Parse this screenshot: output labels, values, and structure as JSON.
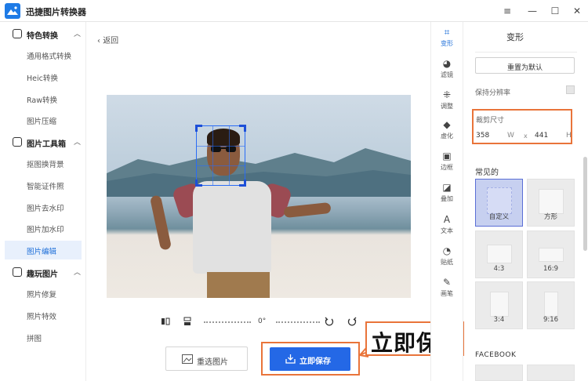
{
  "app": {
    "title": "迅捷图片转换器"
  },
  "window": {
    "menu_icon": "≡",
    "minimize_icon": "—",
    "maximize_icon": "☐",
    "close_icon": "✕"
  },
  "sidebar": {
    "groups": [
      {
        "label": "特色转换",
        "items": [
          "通用格式转换",
          "Heic转换",
          "Raw转换",
          "图片压缩"
        ]
      },
      {
        "label": "图片工具箱",
        "items": [
          "抠图换背景",
          "智能证件照",
          "图片去水印",
          "图片加水印",
          "图片编辑"
        ]
      },
      {
        "label": "趣玩图片",
        "items": [
          "照片修复",
          "照片特效",
          "拼图"
        ]
      }
    ],
    "active_item": "图片编辑"
  },
  "main": {
    "back_label": "返回",
    "rotation_label": "0°",
    "reselect_label": "重选图片",
    "save_label": "立即保存",
    "callout_text": "立即保存"
  },
  "tools": [
    {
      "label": "变形",
      "icon": "crop-icon",
      "glyph": "⌗",
      "active": true
    },
    {
      "label": "滤镜",
      "icon": "filter-icon",
      "glyph": "◕",
      "active": false
    },
    {
      "label": "调整",
      "icon": "adjust-icon",
      "glyph": "⁜",
      "active": false
    },
    {
      "label": "虚化",
      "icon": "blur-icon",
      "glyph": "💧",
      "active": false
    },
    {
      "label": "边框",
      "icon": "frame-icon",
      "glyph": "▣",
      "active": false
    },
    {
      "label": "叠加",
      "icon": "overlay-icon",
      "glyph": "◪",
      "active": false
    },
    {
      "label": "文本",
      "icon": "text-icon",
      "glyph": "A",
      "active": false
    },
    {
      "label": "贴纸",
      "icon": "sticker-icon",
      "glyph": "◔",
      "active": false
    },
    {
      "label": "画笔",
      "icon": "brush-icon",
      "glyph": "✎",
      "active": false
    }
  ],
  "panel": {
    "title": "变形",
    "reset_label": "重置为默认",
    "keep_resolution_label": "保持分辨率",
    "crop_size_label": "裁剪尺寸",
    "crop_width": "358",
    "crop_w_unit": "W",
    "crop_separator": "x",
    "crop_height": "441",
    "crop_h_unit": "H",
    "common_label": "常见的",
    "presets": [
      "自定义",
      "方形",
      "4:3",
      "16:9",
      "3:4",
      "9:16"
    ],
    "selected_preset": "自定义",
    "facebook_label": "FACEBOOK"
  },
  "colors": {
    "accent": "#2468e6",
    "highlight": "#e9743a",
    "selected_preset": "#c7d0f0"
  }
}
